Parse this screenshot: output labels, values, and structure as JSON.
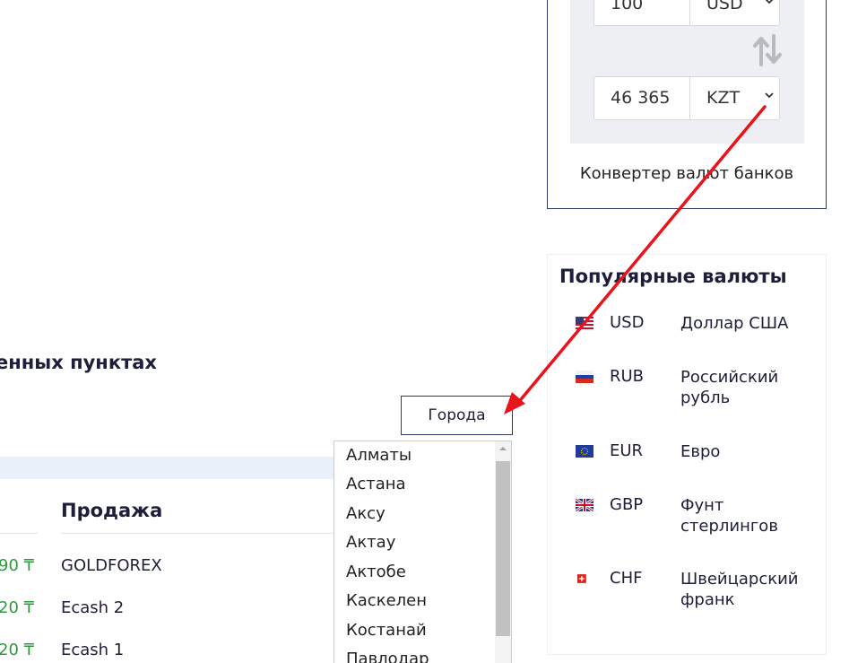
{
  "converter": {
    "from_amount": "100",
    "from_currency": "USD",
    "to_amount": "46 365",
    "to_currency": "KZT",
    "caption": "Конвертер валют банков"
  },
  "popular": {
    "title": "Популярные валюты",
    "items": [
      {
        "code": "USD",
        "name": "Доллар США",
        "flag": "us-flag-icon"
      },
      {
        "code": "RUB",
        "name": "Российский рубль",
        "flag": "ru-flag-icon"
      },
      {
        "code": "EUR",
        "name": "Евро",
        "flag": "eu-flag-icon"
      },
      {
        "code": "GBP",
        "name": "Фунт стерлингов",
        "flag": "uk-flag-icon"
      },
      {
        "code": "CHF",
        "name": "Швейцарский франк",
        "flag": "ch-flag-icon"
      }
    ]
  },
  "section": {
    "title": "енных пунктах",
    "city_button": "Города",
    "column_header": "Продажа"
  },
  "rows": [
    {
      "rate": "90 ₸",
      "seller": "GOLDFOREX"
    },
    {
      "rate": "20 ₸",
      "seller": "Ecash 2"
    },
    {
      "rate": "20 ₸",
      "seller": "Ecash 1"
    }
  ],
  "cities": [
    "Алматы",
    "Астана",
    "Аксу",
    "Актау",
    "Актобе",
    "Каскелен",
    "Костанай",
    "Павлодар"
  ],
  "colors": {
    "accent_border": "#2d3a6b",
    "rate_green": "#2f9a3d",
    "arrow_red": "#e8141b",
    "band_blue": "#e8f0fa"
  }
}
